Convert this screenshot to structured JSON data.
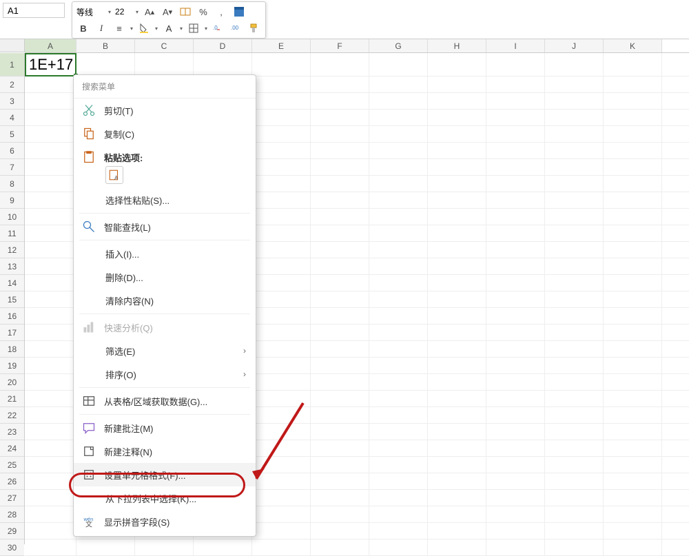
{
  "namebox": {
    "value": "A1"
  },
  "toolbar": {
    "font_name": "等线",
    "font_size": "22",
    "bold": "B",
    "italic": "I"
  },
  "cell": {
    "value": "1E+17"
  },
  "columns": [
    "A",
    "B",
    "C",
    "D",
    "E",
    "F",
    "G",
    "H",
    "I",
    "J",
    "K"
  ],
  "rows": [
    "1",
    "2",
    "3",
    "4",
    "5",
    "6",
    "7",
    "8",
    "9",
    "10",
    "11",
    "12",
    "13",
    "14",
    "15",
    "16",
    "17",
    "18",
    "19",
    "20",
    "21",
    "22",
    "23",
    "24",
    "25",
    "26",
    "27",
    "28",
    "29",
    "30"
  ],
  "menu": {
    "search": "搜索菜单",
    "cut": "剪切(T)",
    "copy": "复制(C)",
    "paste_options": "粘贴选项:",
    "paste_special": "选择性粘贴(S)...",
    "smart_lookup": "智能查找(L)",
    "insert": "插入(I)...",
    "delete": "删除(D)...",
    "clear": "清除内容(N)",
    "quick_analysis": "快速分析(Q)",
    "filter": "筛选(E)",
    "sort": "排序(O)",
    "get_data": "从表格/区域获取数据(G)...",
    "new_comment": "新建批注(M)",
    "new_note": "新建注释(N)",
    "format_cells": "设置单元格格式(F)...",
    "dropdown_list": "从下拉列表中选择(K)...",
    "show_pinyin": "显示拼音字段(S)"
  }
}
